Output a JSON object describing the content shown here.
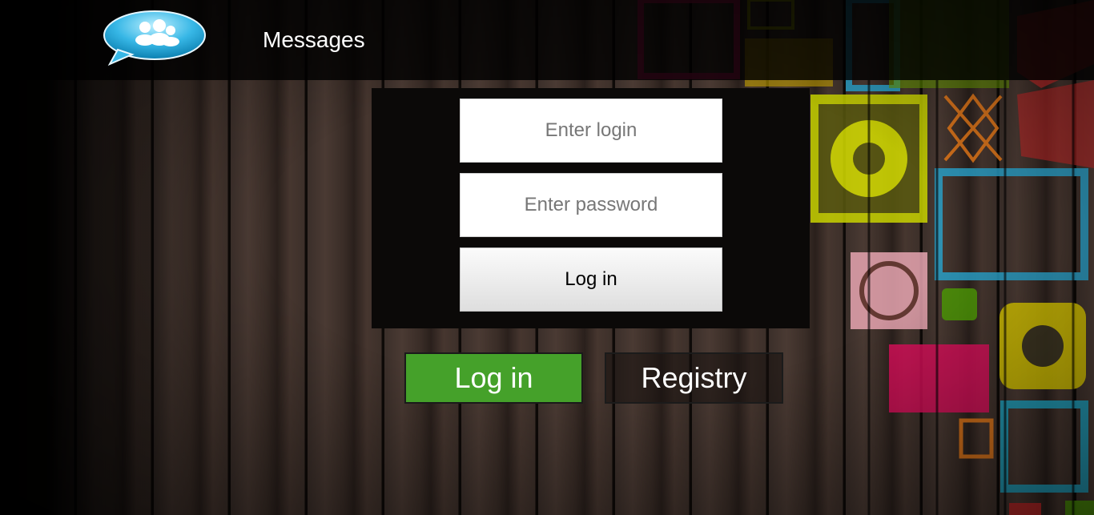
{
  "header": {
    "title": "Messages",
    "logo_icon": "chat-bubble-users-icon",
    "accent": "#37b7e6"
  },
  "login_form": {
    "login_placeholder": "Enter login",
    "password_placeholder": "Enter password",
    "submit_label": "Log in"
  },
  "tabs": {
    "login_label": "Log in",
    "registry_label": "Registry",
    "active_color": "#45a12a"
  }
}
